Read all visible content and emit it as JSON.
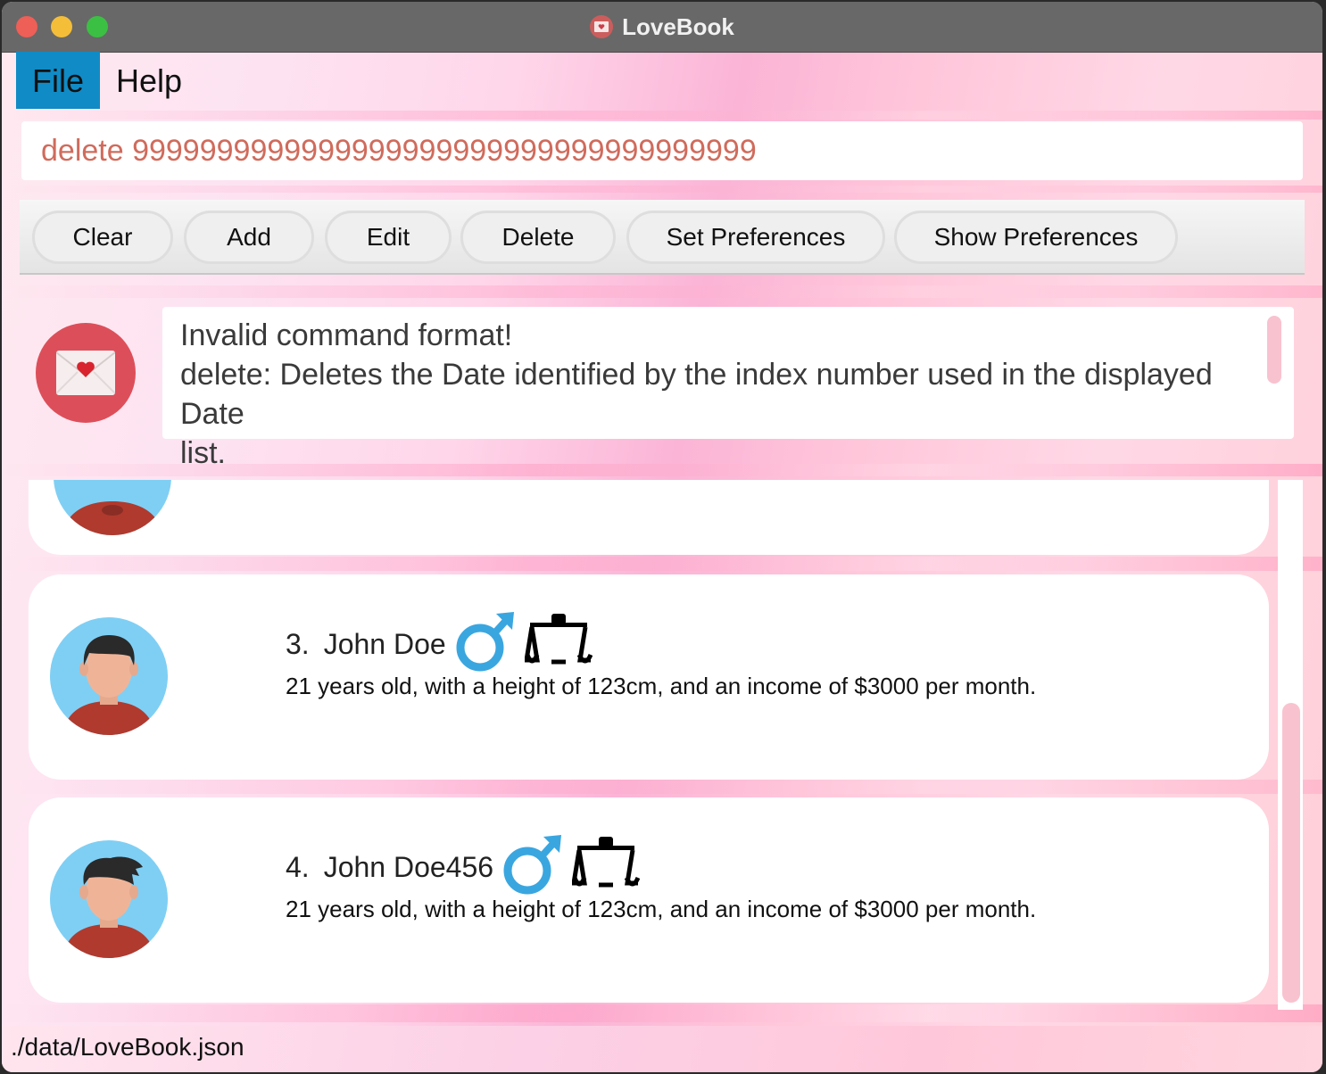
{
  "window": {
    "title": "LoveBook"
  },
  "menu": {
    "items": [
      "File",
      "Help"
    ]
  },
  "command": {
    "value": "delete 9999999999999999999999999999999999999"
  },
  "toolbar": {
    "buttons": [
      "Clear",
      "Add",
      "Edit",
      "Delete",
      "Set Preferences",
      "Show Preferences"
    ]
  },
  "result": {
    "lines": [
      "Invalid command format!",
      "delete: Deletes the Date identified by the index number used in the displayed Date",
      "list."
    ]
  },
  "dates": [
    {
      "index": "3.",
      "name": "John Doe",
      "gender_icon": "male-icon",
      "horoscope_icon": "libra-icon",
      "description": "21 years old, with a height of 123cm, and an income of $3000 per month."
    },
    {
      "index": "4.",
      "name": "John Doe456",
      "gender_icon": "male-icon",
      "horoscope_icon": "libra-icon",
      "description": "21 years old, with a height of 123cm, and an income of $3000 per month."
    }
  ],
  "status": {
    "path": "./data/LoveBook.json"
  },
  "colors": {
    "accent": "#108bc6",
    "command_text": "#d06b5c",
    "mail_circle": "#dc4f5a",
    "male_symbol": "#3aa6e0"
  }
}
